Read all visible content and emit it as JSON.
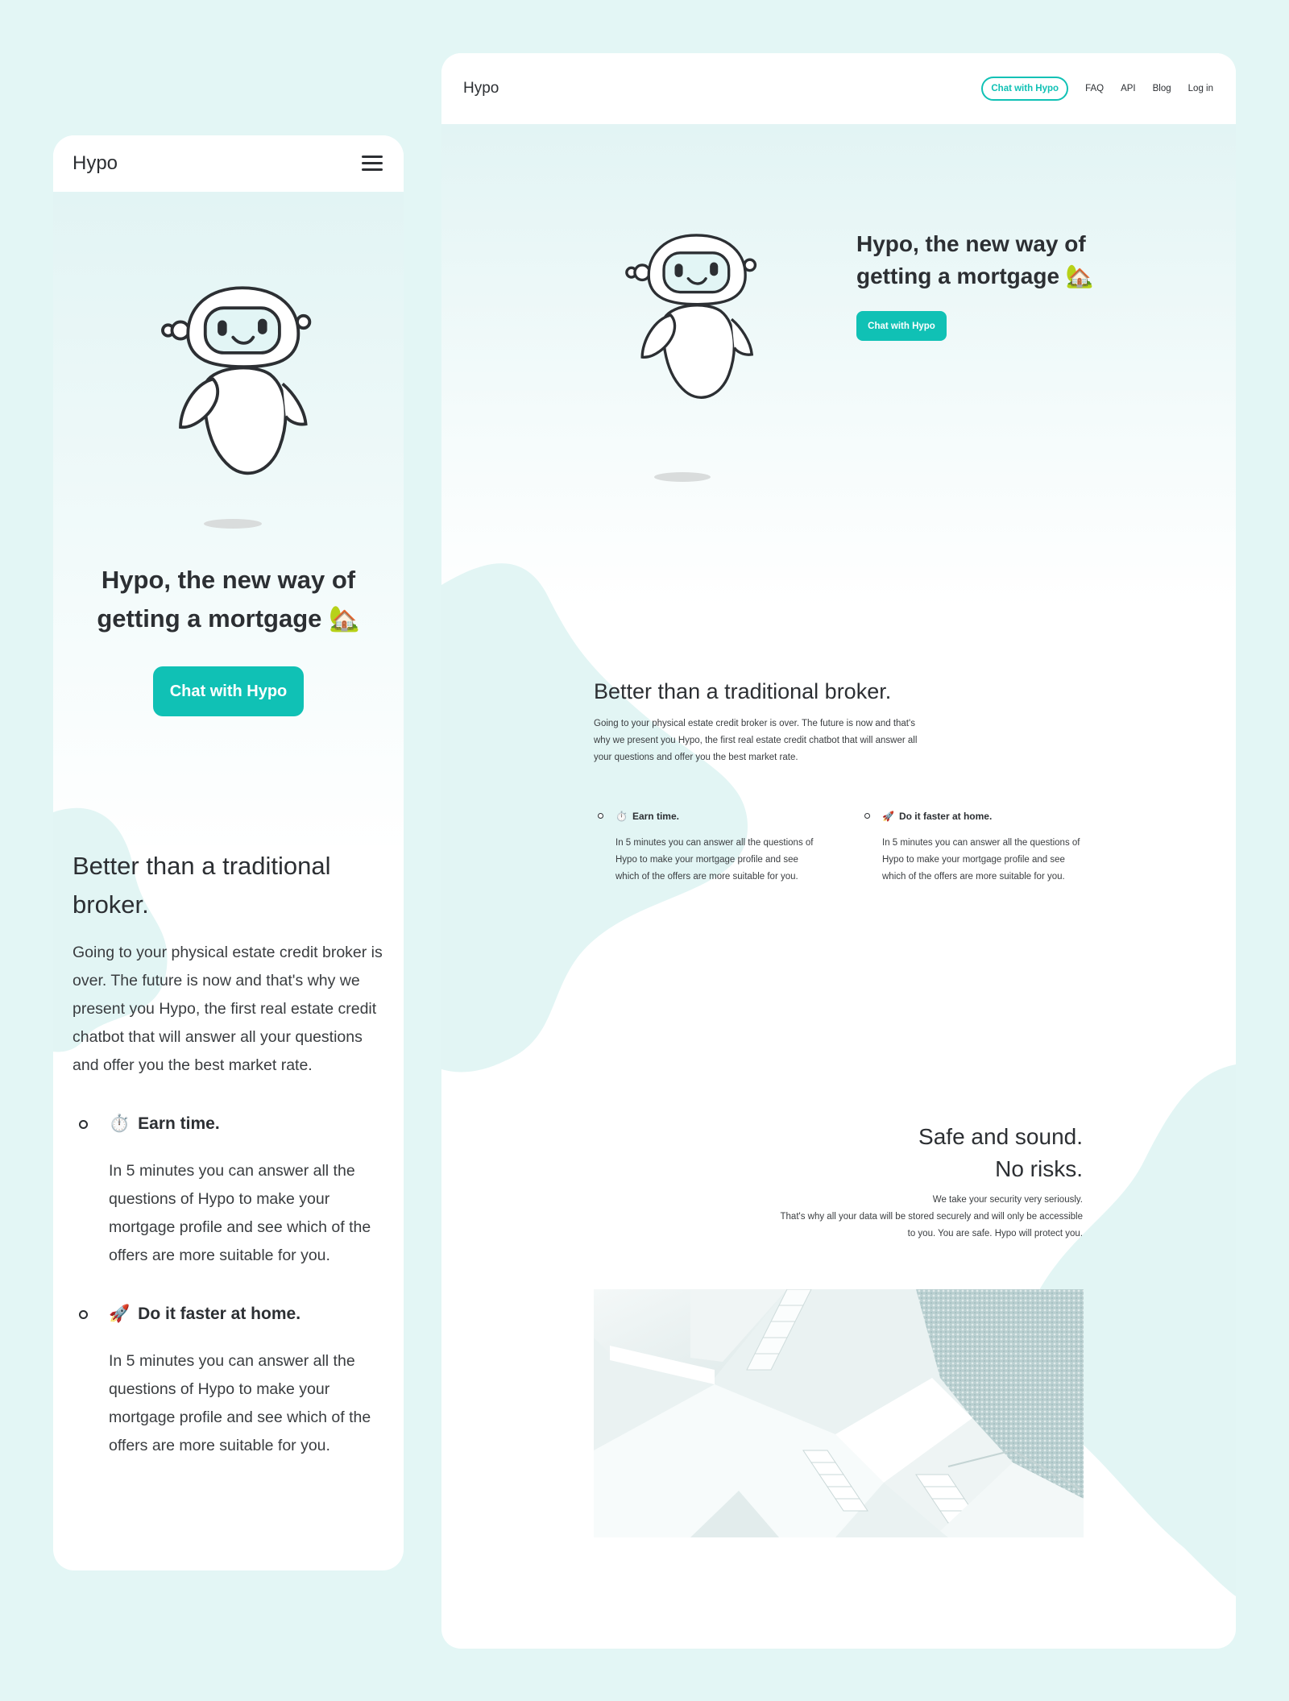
{
  "colors": {
    "background": "#e3f6f5",
    "accent": "#10c1b5",
    "text": "#2c2f33",
    "blob": "#e2f5f4"
  },
  "mobile": {
    "logo": "Hypo",
    "menu_icon": "hamburger-menu-icon",
    "hero": {
      "title_line1": "Hypo, the new way of",
      "title_line2": "getting a mortgage",
      "title_emoji": "🏡",
      "cta": "Chat with Hypo"
    },
    "broker": {
      "title": "Better than a traditional broker.",
      "body": "Going to your physical estate credit broker is over. The future is now and that's why we present you Hypo, the first real estate credit chatbot that will answer all your questions and offer you the best market rate."
    },
    "features": [
      {
        "emoji": "⏱️",
        "title": "Earn time.",
        "desc": "In 5 minutes you can answer all the questions of Hypo to make your mortgage profile and see which of the offers are more suitable for you."
      },
      {
        "emoji": "🚀",
        "title": "Do it faster at home.",
        "desc": "In 5 minutes you can answer all the questions of Hypo to make your mortgage profile and see which of the offers are more suitable for you."
      }
    ]
  },
  "desktop": {
    "logo": "Hypo",
    "nav": {
      "cta": "Chat with Hypo",
      "links": [
        "FAQ",
        "API",
        "Blog",
        "Log in"
      ]
    },
    "hero": {
      "title_line1": "Hypo, the new way of",
      "title_line2": "getting a mortgage",
      "title_emoji": "🏡",
      "cta": "Chat with Hypo"
    },
    "broker": {
      "title": "Better than a traditional broker.",
      "body": "Going to your physical estate credit broker is over. The future is now and that's why we present you Hypo, the first real estate credit chatbot that will answer all your questions and offer you the best market rate."
    },
    "features": [
      {
        "emoji": "⏱️",
        "title": "Earn time.",
        "desc": "In 5 minutes you can answer all the questions of Hypo to make your mortgage profile and see which of the offers are more suitable for you."
      },
      {
        "emoji": "🚀",
        "title": "Do it faster at home.",
        "desc": "In 5 minutes you can answer all the questions of Hypo to make your mortgage profile and see which of the offers are more suitable for you."
      }
    ],
    "safe": {
      "title_line1": "Safe and sound.",
      "title_line2": "No risks.",
      "body_line1": "We take your security very seriously.",
      "body_line2": "That's why all your data will be stored securely and will only be accessible",
      "body_line3": "to you. You are safe. Hypo will protect you."
    },
    "photo": "white-staircase-architecture-photo"
  }
}
